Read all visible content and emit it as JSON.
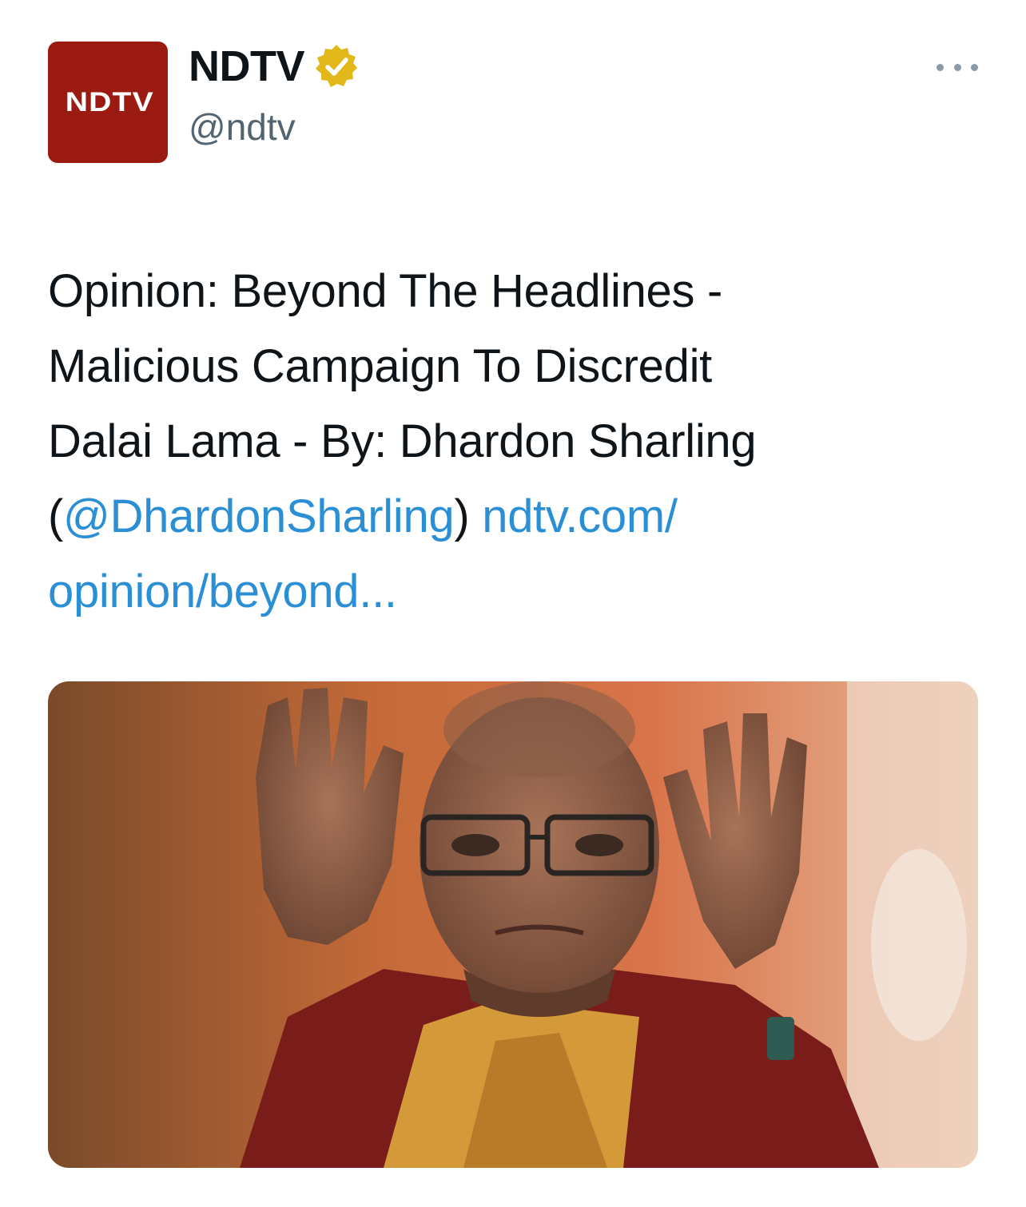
{
  "account": {
    "avatar_text": "NDTV",
    "display_name": "NDTV",
    "handle": "@ndtv",
    "verified": true,
    "verified_icon": "gold-verified-badge-icon"
  },
  "more_icon": "more-horizontal-icon",
  "tweet": {
    "text_line_1": "Opinion: Beyond The Headlines -",
    "text_line_2": "Malicious Campaign To Discredit",
    "text_line_3": "Dalai Lama - By: Dhardon Sharling",
    "open_paren": "(",
    "mention": "@DhardonSharling",
    "close_paren": ")",
    "link_part_1": "ndtv.com/",
    "link_part_2": "opinion/beyond..."
  },
  "media": {
    "type": "photo"
  },
  "colors": {
    "avatar_bg": "#9b1b12",
    "link": "#2b8fd6",
    "verified_gold": "#e2b719",
    "text": "#0f1419",
    "secondary_text": "#536471"
  }
}
